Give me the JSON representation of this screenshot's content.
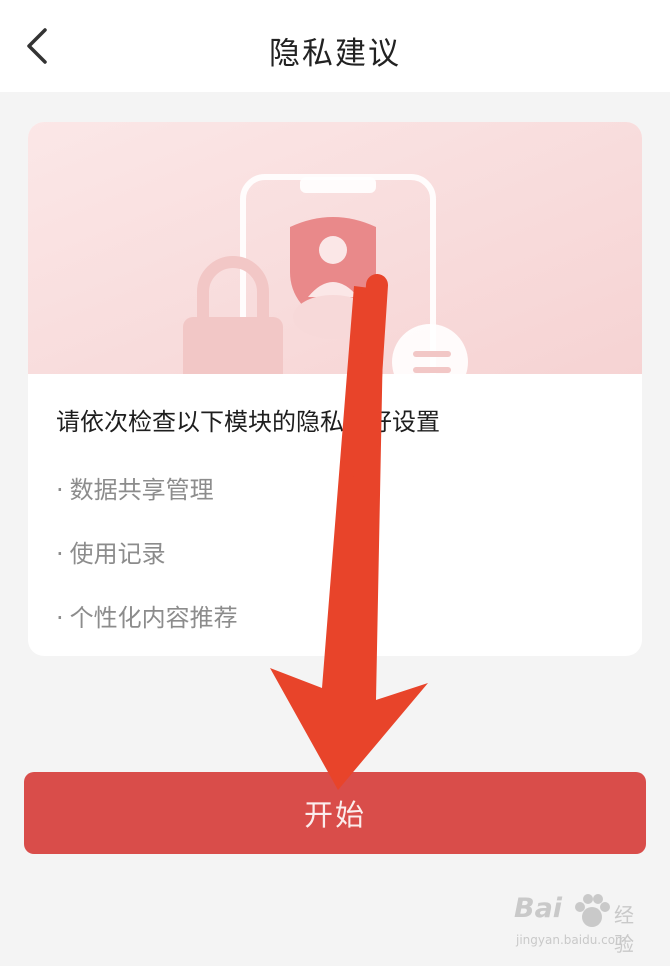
{
  "header": {
    "back_icon": "chevron-left-icon",
    "title": "隐私建议"
  },
  "card": {
    "heading": "请依次检查以下模块的隐私偏好设置",
    "items": [
      {
        "label": "数据共享管理"
      },
      {
        "label": "使用记录"
      },
      {
        "label": "个性化内容推荐"
      }
    ],
    "bullet": "·"
  },
  "start_button": {
    "label": "开始"
  },
  "overlay": {
    "arrow_icon": "down-arrow-annotation-icon",
    "arrow_color": "#e8442a"
  },
  "watermark": {
    "brand": "Bai",
    "brand_cn": "经验",
    "url": "jingyan.baidu.com"
  },
  "colors": {
    "accent": "#d94d4a",
    "background": "#f4f4f4"
  }
}
